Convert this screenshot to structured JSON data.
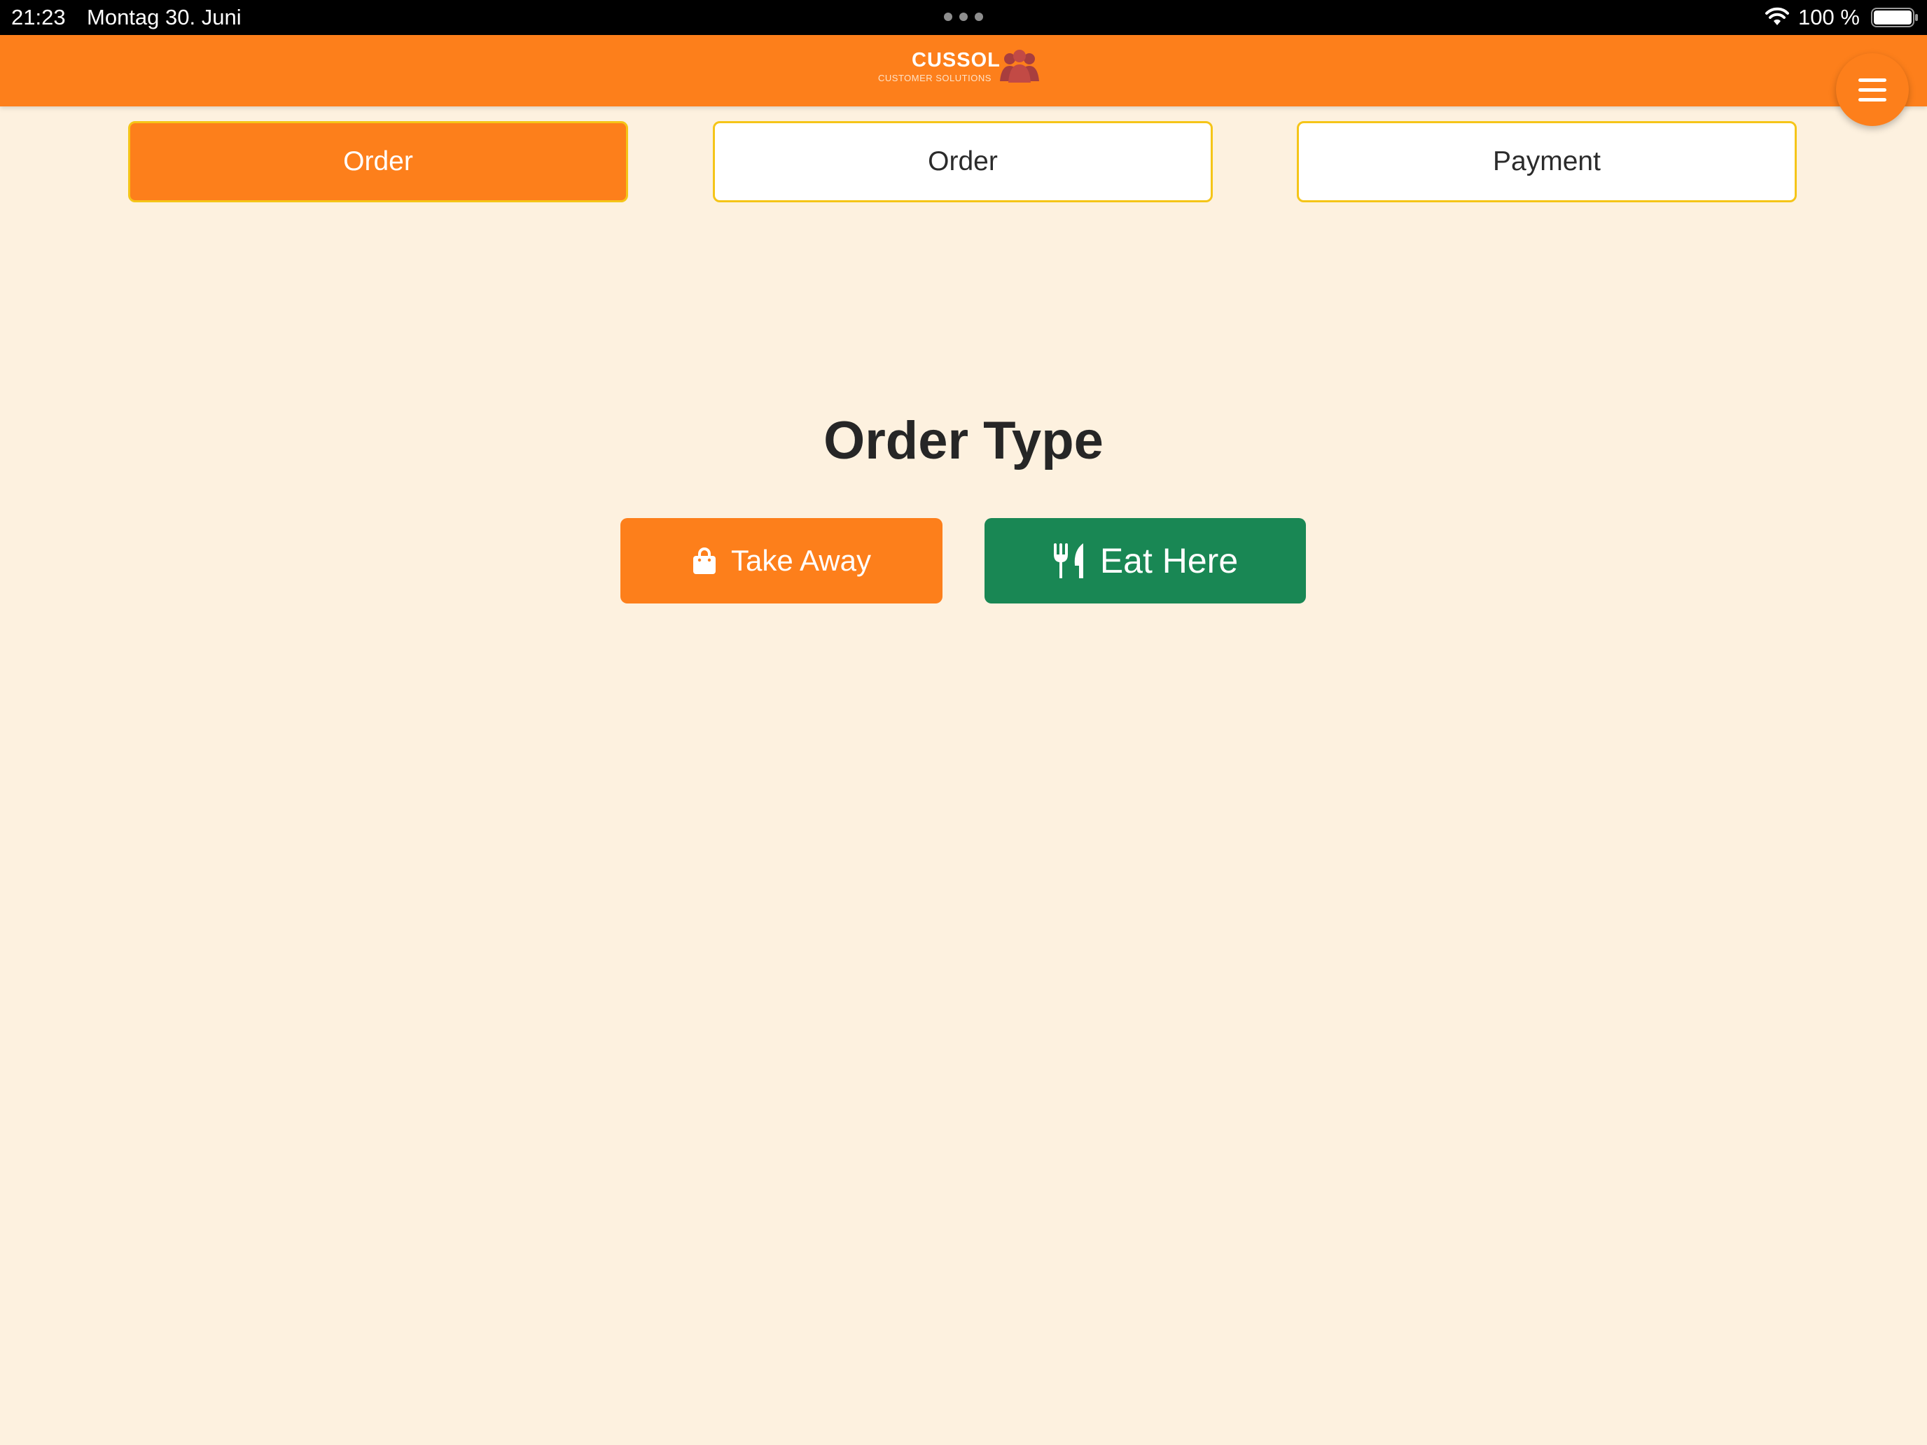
{
  "status_bar": {
    "time": "21:23",
    "date": "Montag 30. Juni",
    "battery_percent": "100 %"
  },
  "header": {
    "logo_title": "CUSSOL",
    "logo_subtitle": "CUSTOMER SOLUTIONS",
    "menu_icon": "hamburger-menu-icon"
  },
  "steps": [
    {
      "label": "Order",
      "active": true
    },
    {
      "label": "Order",
      "active": false
    },
    {
      "label": "Payment",
      "active": false
    }
  ],
  "main": {
    "title": "Order Type",
    "take_away_label": "Take Away",
    "take_away_icon": "shopping-bag-icon",
    "eat_here_label": "Eat Here",
    "eat_here_icon": "utensils-icon"
  },
  "colors": {
    "brand_orange": "#fd7f1b",
    "eat_here_green": "#198754",
    "page_background": "#fdf1df",
    "tab_border": "#f5c518"
  }
}
